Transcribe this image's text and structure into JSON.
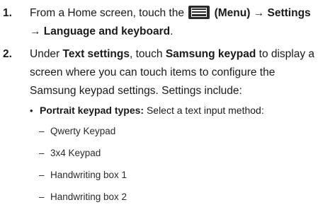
{
  "steps": [
    {
      "number": "1.",
      "line1_prefix": "From a Home screen, touch the",
      "menu_label": "(Menu)",
      "arrow": "→",
      "settings": "Settings",
      "line2": "→ Language and keyboard",
      "line2_suffix": "."
    },
    {
      "number": "2.",
      "line1_prefix": "Under ",
      "line1_bold1": "Text settings",
      "line1_mid": ", touch ",
      "line1_bold2": "Samsung keypad",
      "line1_suffix": " to display a",
      "line2": "screen where you can touch items to configure the",
      "line3": "Samsung keypad settings. Settings include:"
    }
  ],
  "bullet": {
    "marker": "•",
    "label": "Portrait keypad types:",
    "text": " Select a text input method:"
  },
  "sub_items": [
    "Qwerty Keypad",
    "3x4 Keypad",
    "Handwriting box 1",
    "Handwriting box 2"
  ],
  "dash": "–",
  "icons": {
    "menu": "menu-icon"
  }
}
